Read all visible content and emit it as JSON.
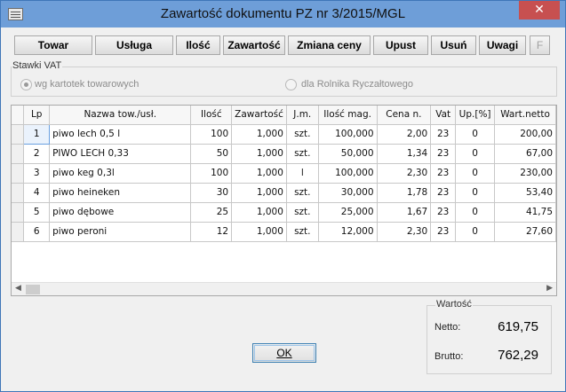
{
  "window": {
    "title": "Zawartość dokumentu PZ nr 3/2015/MGL",
    "close_label": "✕"
  },
  "toolbar": {
    "buttons": [
      "Towar",
      "Usługa",
      "Ilość",
      "Zawartość",
      "Zmiana ceny",
      "Upust",
      "Usuń",
      "Uwagi",
      "F"
    ]
  },
  "vat": {
    "legend": "Stawki VAT",
    "option1": "wg kartotek towarowych",
    "option2": "dla Rolnika Ryczałtowego",
    "selected": "wg kartotek towarowych"
  },
  "grid": {
    "columns": [
      "Lp",
      "Nazwa tow./usł.",
      "Ilość",
      "Zawartość",
      "J.m.",
      "Ilość mag.",
      "Cena n.",
      "Vat",
      "Up.[%]",
      "Wart.netto"
    ],
    "rows": [
      [
        "1",
        "piwo lech 0,5 l",
        "100",
        "1,000",
        "szt.",
        "100,000",
        "2,00",
        "23",
        "0",
        "200,00"
      ],
      [
        "2",
        "PIWO LECH 0,33",
        "50",
        "1,000",
        "szt.",
        "50,000",
        "1,34",
        "23",
        "0",
        "67,00"
      ],
      [
        "3",
        "piwo keg  0,3l",
        "100",
        "1,000",
        "l",
        "100,000",
        "2,30",
        "23",
        "0",
        "230,00"
      ],
      [
        "4",
        "piwo heineken",
        "30",
        "1,000",
        "szt.",
        "30,000",
        "1,78",
        "23",
        "0",
        "53,40"
      ],
      [
        "5",
        "piwo dębowe",
        "25",
        "1,000",
        "szt.",
        "25,000",
        "1,67",
        "23",
        "0",
        "41,75"
      ],
      [
        "6",
        "piwo peroni",
        "12",
        "1,000",
        "szt.",
        "12,000",
        "2,30",
        "23",
        "0",
        "27,60"
      ]
    ]
  },
  "summary": {
    "legend": "Wartość",
    "netto_label": "Netto:",
    "netto_value": "619,75",
    "brutto_label": "Brutto:",
    "brutto_value": "762,29"
  },
  "ok_button": {
    "label": "OK"
  }
}
